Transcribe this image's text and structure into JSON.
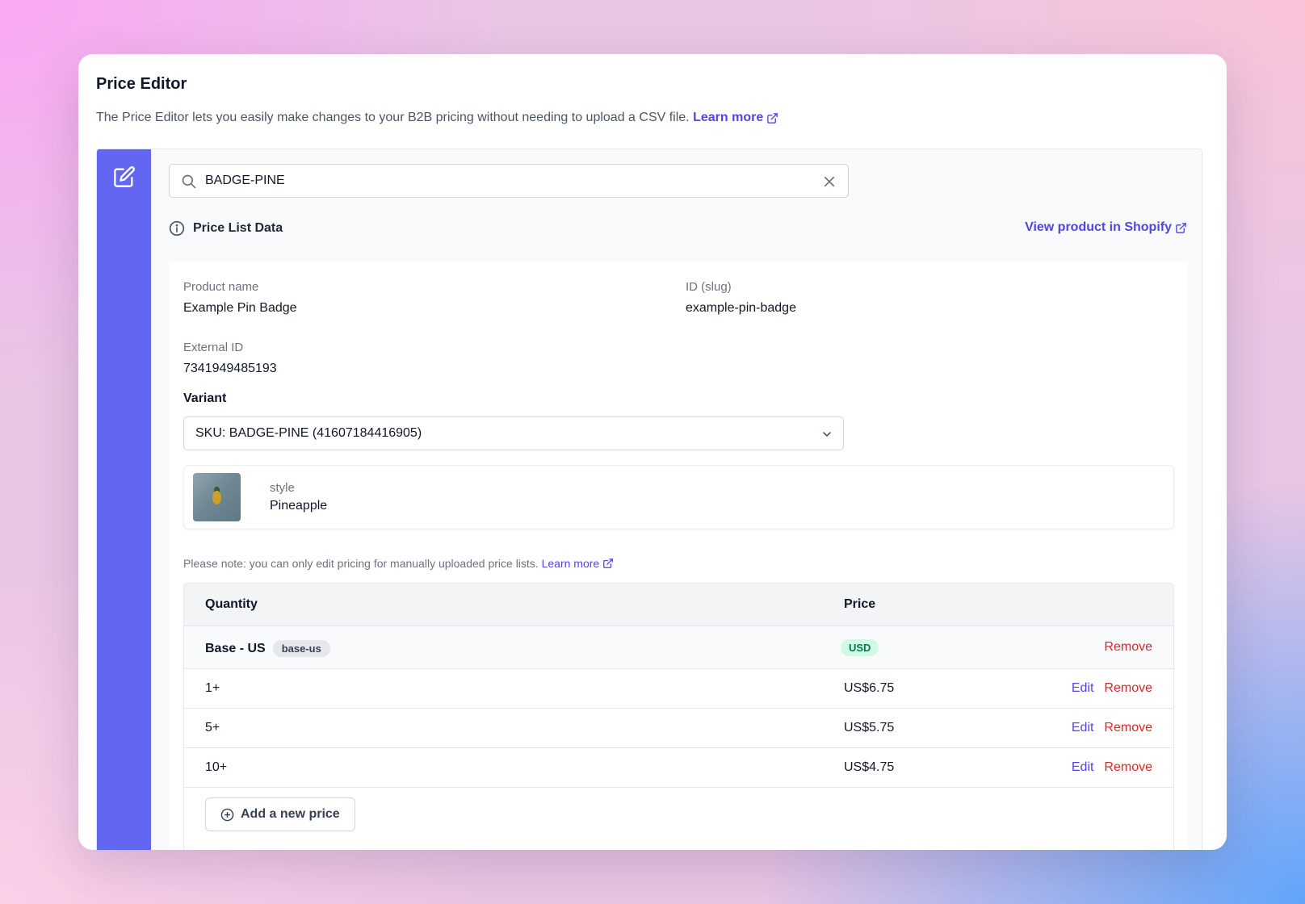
{
  "header": {
    "title": "Price Editor",
    "description": "The Price Editor lets you easily make changes to your B2B pricing without needing to upload a CSV file.",
    "learn_more": "Learn more"
  },
  "search": {
    "value": "BADGE-PINE"
  },
  "section": {
    "title": "Price List Data",
    "view_link": "View product in Shopify"
  },
  "product": {
    "name_label": "Product name",
    "name_value": "Example Pin Badge",
    "slug_label": "ID (slug)",
    "slug_value": "example-pin-badge",
    "external_label": "External ID",
    "external_value": "7341949485193"
  },
  "variant": {
    "label": "Variant",
    "selected": "SKU: BADGE-PINE (41607184416905)",
    "option_name": "style",
    "option_value": "Pineapple"
  },
  "note": {
    "text": "Please note: you can only edit pricing for manually uploaded price lists.",
    "learn_more": "Learn more"
  },
  "table": {
    "col_quantity": "Quantity",
    "col_price": "Price",
    "group": {
      "name": "Base - US",
      "tag": "base-us",
      "currency": "USD",
      "remove": "Remove"
    },
    "rows": [
      {
        "quantity": "1+",
        "price": "US$6.75",
        "edit": "Edit",
        "remove": "Remove"
      },
      {
        "quantity": "5+",
        "price": "US$5.75",
        "edit": "Edit",
        "remove": "Remove"
      },
      {
        "quantity": "10+",
        "price": "US$4.75",
        "edit": "Edit",
        "remove": "Remove"
      }
    ],
    "add_button": "Add a new price"
  },
  "colors": {
    "accent": "#6366f1",
    "link": "#4f46e5",
    "danger": "#dc2626",
    "success_bg": "#d1fae5",
    "success_text": "#047857"
  }
}
